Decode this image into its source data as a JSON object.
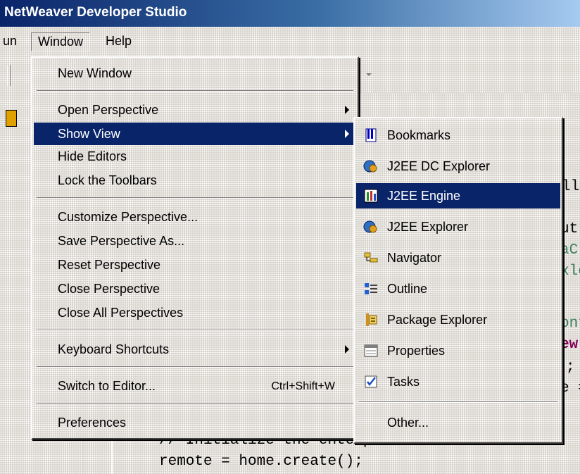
{
  "window": {
    "title": "NetWeaver Developer Studio"
  },
  "menubar": {
    "run_partial": "un",
    "window": "Window",
    "help": "Help"
  },
  "main_menu": {
    "items": [
      {
        "label": "New Window"
      },
      {
        "label": "Open Perspective",
        "submenu": true
      },
      {
        "label": "Show View",
        "submenu": true,
        "selected": true
      },
      {
        "label": "Hide Editors"
      },
      {
        "label": "Lock the Toolbars"
      },
      {
        "label": "Customize Perspective..."
      },
      {
        "label": "Save Perspective As..."
      },
      {
        "label": "Reset Perspective"
      },
      {
        "label": "Close Perspective"
      },
      {
        "label": "Close All Perspectives"
      },
      {
        "label": "Keyboard Shortcuts",
        "submenu": true
      },
      {
        "label": "Switch to Editor...",
        "shortcut": "Ctrl+Shift+W"
      },
      {
        "label": "Preferences"
      }
    ]
  },
  "show_view_menu": {
    "items": [
      {
        "label": "Bookmarks",
        "icon": "bookmarks-icon"
      },
      {
        "label": "J2EE DC Explorer",
        "icon": "j2ee-dc-explorer-icon"
      },
      {
        "label": "J2EE Engine",
        "icon": "j2ee-engine-icon",
        "selected": true
      },
      {
        "label": "J2EE Explorer",
        "icon": "j2ee-explorer-icon"
      },
      {
        "label": "Navigator",
        "icon": "navigator-icon"
      },
      {
        "label": "Outline",
        "icon": "outline-icon"
      },
      {
        "label": "Package Explorer",
        "icon": "package-explorer-icon"
      },
      {
        "label": "Properties",
        "icon": "properties-icon"
      },
      {
        "label": "Tasks",
        "icon": "tasks-icon"
      },
      {
        "label": "Other..."
      }
    ]
  },
  "editor": {
    "fragments": [
      "ll",
      "ut",
      "aC",
      "xle",
      "ont",
      "ew",
      ";",
      "e ="
    ],
    "comment_line": "// Initialize the enterprise bean",
    "code_line": "remote = home.create();"
  },
  "colors": {
    "selection": "#0a246a",
    "menu_bg": "#d4d0c8",
    "keyword": "#7f0055"
  }
}
